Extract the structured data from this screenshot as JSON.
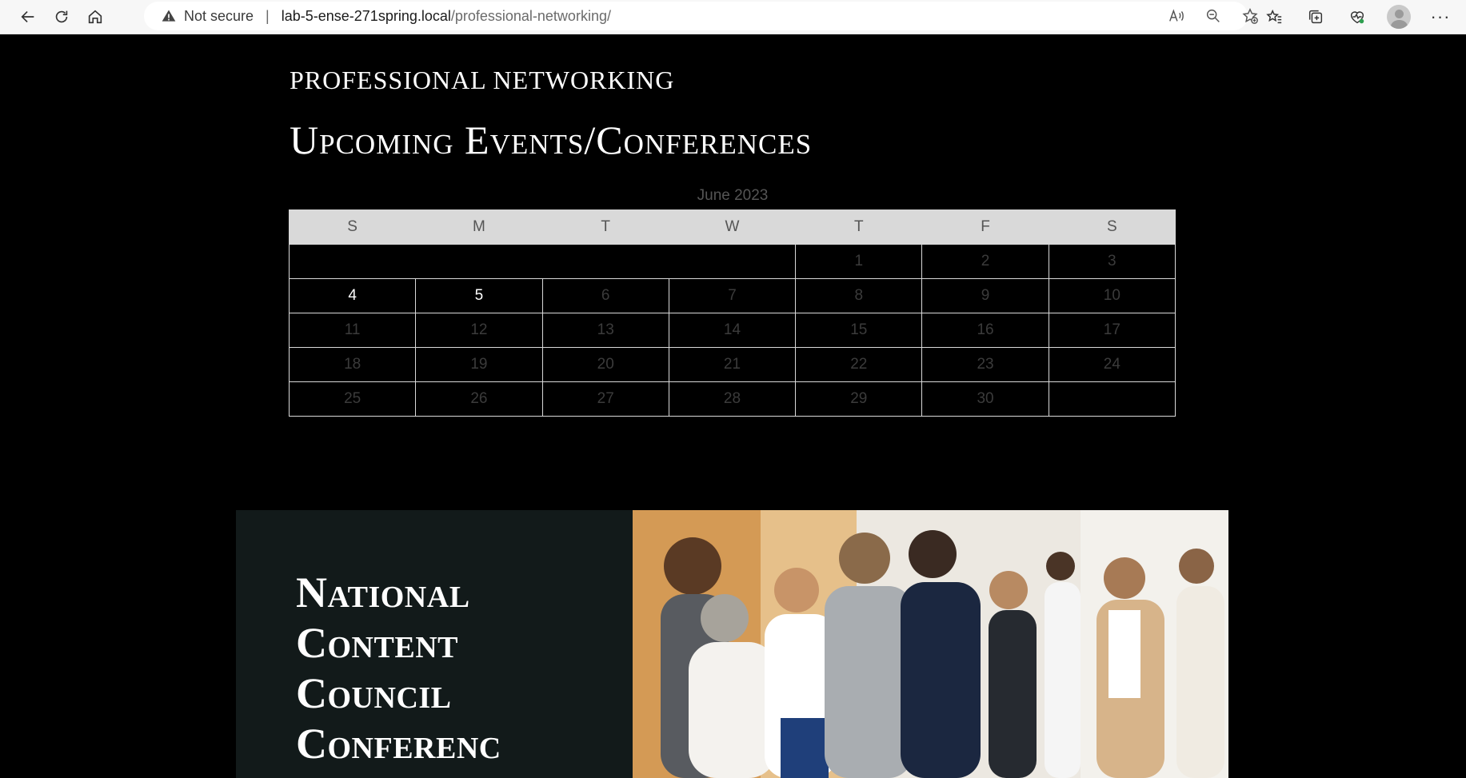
{
  "browser": {
    "security_label": "Not secure",
    "url_host": "lab-5-ense-271spring.local",
    "url_path": "/professional-networking/"
  },
  "page": {
    "site_title": "PROFESSIONAL NETWORKING",
    "heading": "Upcoming Events/Conferences"
  },
  "calendar": {
    "caption": "June 2023",
    "weekdays": [
      "S",
      "M",
      "T",
      "W",
      "T",
      "F",
      "S"
    ],
    "weeks": [
      [
        "",
        "",
        "",
        "",
        "1",
        "2",
        "3"
      ],
      [
        "4",
        "5",
        "6",
        "7",
        "8",
        "9",
        "10"
      ],
      [
        "11",
        "12",
        "13",
        "14",
        "15",
        "16",
        "17"
      ],
      [
        "18",
        "19",
        "20",
        "21",
        "22",
        "23",
        "24"
      ],
      [
        "25",
        "26",
        "27",
        "28",
        "29",
        "30",
        ""
      ]
    ],
    "event_days": [
      "4",
      "5"
    ]
  },
  "feature": {
    "title_lines": [
      "National",
      "Content",
      "Council",
      "Conferenc"
    ],
    "photo_alt": "Group of professionals networking at a conference"
  },
  "colors": {
    "page_bg": "#000000",
    "calendar_header_bg": "#d9d9d9",
    "feature_panel_bg": "#121a1a"
  }
}
